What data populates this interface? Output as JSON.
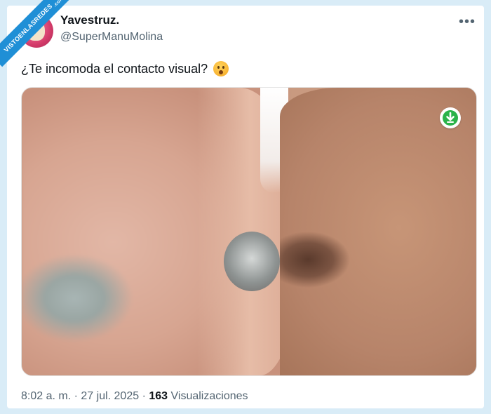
{
  "watermark": {
    "text": "VISTOENLASREDES",
    "suffix": ".com"
  },
  "author": {
    "name": "Yavestruz.",
    "handle": "@SuperManuMolina"
  },
  "post": {
    "text": "¿Te incomoda el contacto visual?",
    "emoji_icon": "astonished-face-emoji"
  },
  "meta": {
    "time": "8:02 a. m.",
    "separator1": "·",
    "date": "27 jul. 2025",
    "separator2": "·",
    "views_count": "163",
    "views_label": "Visualizaciones"
  },
  "icons": {
    "more": "more-options-icon",
    "download": "download-icon"
  },
  "colors": {
    "accent": "#1f8fd6",
    "download_badge": "#2bb34a",
    "background": "#d9ecf7"
  }
}
